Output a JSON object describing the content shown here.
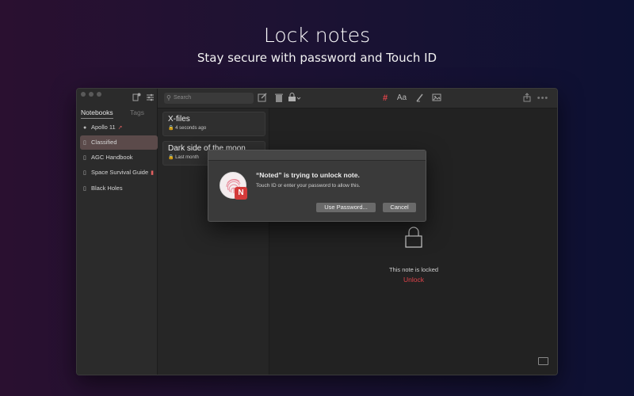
{
  "promo": {
    "headline": "Lock notes",
    "subline": "Stay secure with password and Touch ID"
  },
  "toolbar": {
    "search_placeholder": "Search",
    "hashtag_icon_color": "#e0434a"
  },
  "sidebar": {
    "tabs": [
      {
        "label": "Notebooks",
        "active": true
      },
      {
        "label": "Tags",
        "active": false
      }
    ],
    "notebooks": [
      {
        "label": "Apollo 11",
        "icon": "compass-icon",
        "emoji": "rocket"
      },
      {
        "label": "Classified",
        "icon": "notebook-icon",
        "selected": true
      },
      {
        "label": "AGC Handbook",
        "icon": "notebook-icon"
      },
      {
        "label": "Space Survival Guide",
        "icon": "notebook-icon",
        "emoji": "fire-extinguisher"
      },
      {
        "label": "Black Holes",
        "icon": "notebook-icon"
      }
    ]
  },
  "notes": [
    {
      "title": "X-files",
      "meta": "4 seconds ago"
    },
    {
      "title": "Dark side of the moon",
      "meta": "Last month"
    }
  ],
  "editor": {
    "locked_text": "This note is locked",
    "unlock_label": "Unlock"
  },
  "dialog": {
    "title": "“Noted” is trying to unlock note.",
    "message": "Touch ID or enter your password to allow this.",
    "use_password_label": "Use Password...",
    "cancel_label": "Cancel",
    "app_badge": "N"
  }
}
